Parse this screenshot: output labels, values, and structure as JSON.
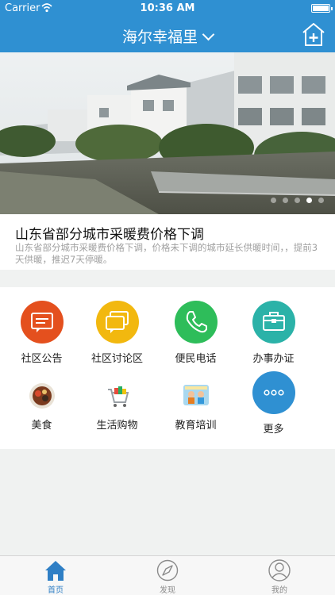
{
  "status_bar": {
    "carrier": "Carrier",
    "time": "10:36 AM"
  },
  "nav": {
    "title": "海尔幸福里"
  },
  "banner": {
    "page_count": 5,
    "active_page": 4
  },
  "news": {
    "title": "山东省部分城市采暖费价格下调",
    "desc": "山东省部分城市采暖费价格下调，价格未下调的城市延长供暖时间，，提前3天供暖，推迟7天停暖。"
  },
  "services": [
    {
      "label": "社区公告",
      "icon": "notice-icon",
      "color": "#e4501e"
    },
    {
      "label": "社区讨论区",
      "icon": "chat-icon",
      "color": "#f2b80f"
    },
    {
      "label": "便民电话",
      "icon": "phone-icon",
      "color": "#2ebd5a"
    },
    {
      "label": "办事办证",
      "icon": "briefcase-icon",
      "color": "#2bb2a8"
    },
    {
      "label": "美食",
      "icon": "food-icon"
    },
    {
      "label": "生活购物",
      "icon": "shopping-cart-icon"
    },
    {
      "label": "教育培训",
      "icon": "education-icon"
    },
    {
      "label": "更多",
      "icon": "more-icon",
      "color": "#2f90d2"
    }
  ],
  "tabs": [
    {
      "label": "首页",
      "icon": "home-icon",
      "active": true
    },
    {
      "label": "发现",
      "icon": "compass-icon",
      "active": false
    },
    {
      "label": "我的",
      "icon": "profile-icon",
      "active": false
    }
  ]
}
